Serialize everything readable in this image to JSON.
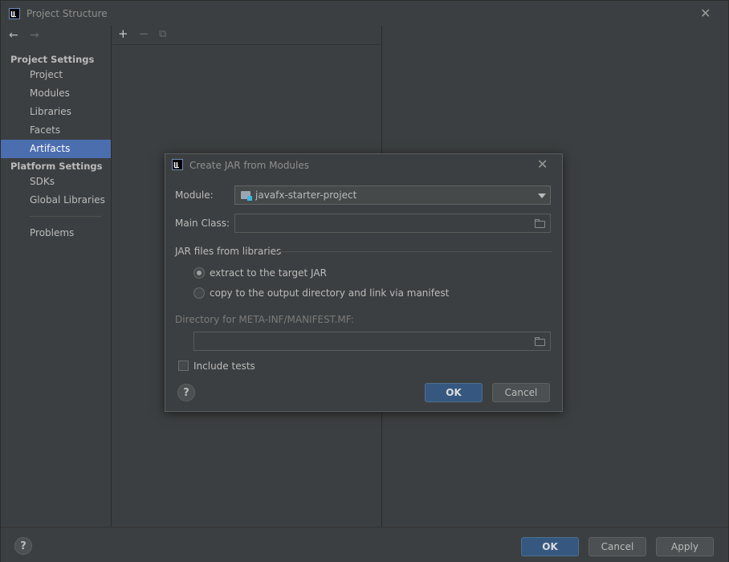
{
  "window": {
    "title": "Project Structure",
    "close_glyph": "✕"
  },
  "nav": {
    "back_glyph": "←",
    "forward_glyph": "→"
  },
  "sidebar": {
    "project_settings_header": "Project Settings",
    "project_items": [
      {
        "label": "Project"
      },
      {
        "label": "Modules"
      },
      {
        "label": "Libraries"
      },
      {
        "label": "Facets"
      },
      {
        "label": "Artifacts",
        "selected": true
      }
    ],
    "platform_settings_header": "Platform Settings",
    "platform_items": [
      {
        "label": "SDKs"
      },
      {
        "label": "Global Libraries"
      }
    ],
    "problems_label": "Problems"
  },
  "toolbar": {
    "add_glyph": "+",
    "remove_glyph": "−",
    "copy_glyph": "⧉"
  },
  "dialog": {
    "title": "Create JAR from Modules",
    "close_glyph": "✕",
    "module_label": "Module:",
    "module_value": "javafx-starter-project",
    "main_class_label": "Main Class:",
    "main_class_value": "",
    "jar_group_title": "JAR files from libraries",
    "radio_extract_label": "extract to the target JAR",
    "radio_copy_label": "copy to the output directory and link via manifest",
    "selected_radio": "extract",
    "manifest_dir_label": "Directory for META-INF/MANIFEST.MF:",
    "manifest_dir_value": "",
    "include_tests_label": "Include tests",
    "include_tests_checked": false,
    "help_glyph": "?",
    "ok_label": "OK",
    "cancel_label": "Cancel"
  },
  "bottom": {
    "help_glyph": "?",
    "ok_label": "OK",
    "cancel_label": "Cancel",
    "apply_label": "Apply"
  },
  "colors": {
    "background": "#3c3f41",
    "selection": "#4b6eaf",
    "primary_button": "#365880",
    "text": "#bbbbbb"
  }
}
